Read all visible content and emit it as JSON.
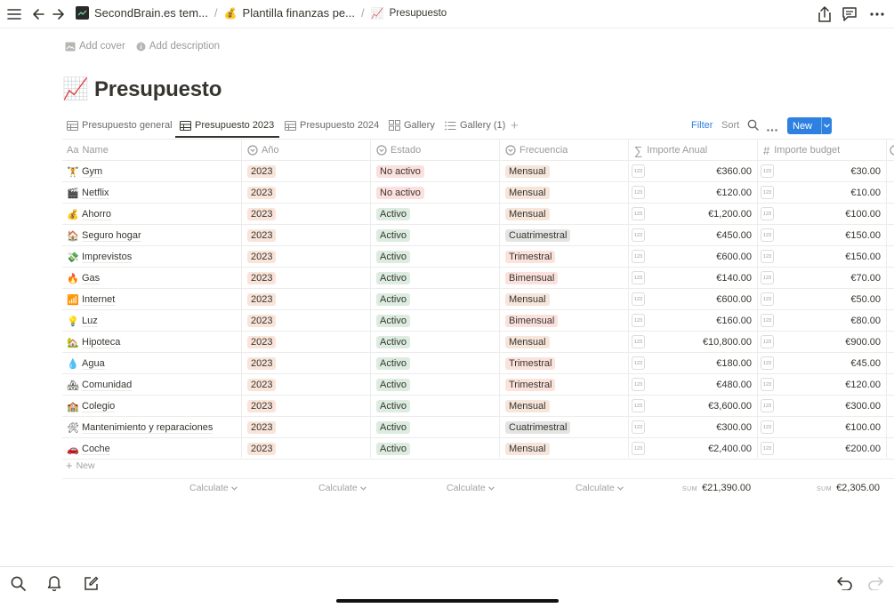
{
  "topbar": {
    "breadcrumbs": [
      {
        "icon": "secondbrain-logo",
        "label": "SecondBrain.es tem..."
      },
      {
        "icon": "money-bag-emoji",
        "emoji": "💰",
        "label": "Plantilla finanzas pe..."
      },
      {
        "icon": "chart-increasing-emoji",
        "emoji": "📈",
        "label": "Presupuesto"
      }
    ],
    "separator": "/"
  },
  "page": {
    "add_cover": "Add cover",
    "add_description": "Add description",
    "title_emoji": "📈",
    "title": "Presupuesto"
  },
  "views": {
    "tabs": [
      "Presupuesto general",
      "Presupuesto 2023",
      "Presupuesto 2024",
      "Gallery",
      "Gallery (1)"
    ],
    "active_index": 1,
    "filter": "Filter",
    "sort": "Sort",
    "new_button": "New"
  },
  "table": {
    "columns": [
      "Name",
      "Año",
      "Estado",
      "Frecuencia",
      "Importe Anual",
      "Importe budget"
    ],
    "rows": [
      {
        "emoji": "🏋",
        "name": "Gym",
        "year": "2023",
        "status": "No activo",
        "freq": "Mensual",
        "annual": "€360.00",
        "budget": "€30.00"
      },
      {
        "emoji": "🎬",
        "name": "Netflix",
        "year": "2023",
        "status": "No activo",
        "freq": "Mensual",
        "annual": "€120.00",
        "budget": "€10.00"
      },
      {
        "emoji": "💰",
        "name": "Ahorro",
        "year": "2023",
        "status": "Activo",
        "freq": "Mensual",
        "annual": "€1,200.00",
        "budget": "€100.00"
      },
      {
        "emoji": "🏠",
        "name": "Seguro hogar",
        "year": "2023",
        "status": "Activo",
        "freq": "Cuatrimestral",
        "annual": "€450.00",
        "budget": "€150.00"
      },
      {
        "emoji": "💸",
        "name": "Imprevistos",
        "year": "2023",
        "status": "Activo",
        "freq": "Trimestral",
        "annual": "€600.00",
        "budget": "€150.00"
      },
      {
        "emoji": "🔥",
        "name": "Gas",
        "year": "2023",
        "status": "Activo",
        "freq": "Bimensual",
        "annual": "€140.00",
        "budget": "€70.00"
      },
      {
        "emoji": "📶",
        "name": "Internet",
        "year": "2023",
        "status": "Activo",
        "freq": "Mensual",
        "annual": "€600.00",
        "budget": "€50.00"
      },
      {
        "emoji": "💡",
        "name": "Luz",
        "year": "2023",
        "status": "Activo",
        "freq": "Bimensual",
        "annual": "€160.00",
        "budget": "€80.00"
      },
      {
        "emoji": "🏡",
        "name": "Hipoteca",
        "year": "2023",
        "status": "Activo",
        "freq": "Mensual",
        "annual": "€10,800.00",
        "budget": "€900.00"
      },
      {
        "emoji": "💧",
        "name": "Agua",
        "year": "2023",
        "status": "Activo",
        "freq": "Trimestral",
        "annual": "€180.00",
        "budget": "€45.00"
      },
      {
        "emoji": "🏘",
        "name": "Comunidad",
        "year": "2023",
        "status": "Activo",
        "freq": "Trimestral",
        "annual": "€480.00",
        "budget": "€120.00"
      },
      {
        "emoji": "🏫",
        "name": "Colegio",
        "year": "2023",
        "status": "Activo",
        "freq": "Mensual",
        "annual": "€3,600.00",
        "budget": "€300.00"
      },
      {
        "emoji": "🛠",
        "name": "Mantenimiento y reparaciones",
        "year": "2023",
        "status": "Activo",
        "freq": "Cuatrimestral",
        "annual": "€300.00",
        "budget": "€100.00"
      },
      {
        "emoji": "🚗",
        "name": "Coche",
        "year": "2023",
        "status": "Activo",
        "freq": "Mensual",
        "annual": "€2,400.00",
        "budget": "€200.00"
      }
    ],
    "number_badge": "123",
    "new_row": "New",
    "footer": {
      "calculate": "Calculate",
      "sum_label": "SUM",
      "sum_annual": "€21,390.00",
      "sum_budget": "€2,305.00"
    }
  },
  "colors": {
    "year_tag": "#f9e4d9",
    "status_inactive": "#fbe0dd",
    "status_active": "#dcece1",
    "freq_mensual": "#f6e5da",
    "freq_cuatrimestral": "#e4e4e3",
    "freq_trimestral": "#fbe3dc",
    "freq_bimensual": "#fbe1dd",
    "accent": "#2f81e1"
  }
}
